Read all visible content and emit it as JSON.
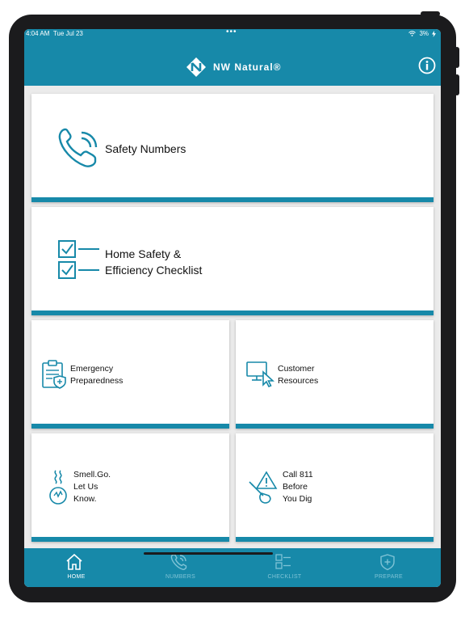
{
  "statusbar": {
    "time": "4:04 AM",
    "date": "Tue Jul 23",
    "battery": "3%"
  },
  "header": {
    "brand": "NW Natural®",
    "logo_icon": "nw-natural-logo-icon",
    "info_icon": "info-icon"
  },
  "cards": {
    "safety_numbers": "Safety Numbers",
    "checklist_line1": "Home Safety &",
    "checklist_line2": "Efficiency Checklist",
    "emergency_line1": "Emergency",
    "emergency_line2": "Preparedness",
    "customer_line1": "Customer",
    "customer_line2": "Resources",
    "smell_line1": "Smell.Go.",
    "smell_line2": "Let Us",
    "smell_line3": "Know.",
    "call_line1": "Call 811",
    "call_line2": "Before",
    "call_line3": "You Dig"
  },
  "tabs": [
    {
      "label": "HOME",
      "icon": "home-icon",
      "active": true
    },
    {
      "label": "NUMBERS",
      "icon": "phone-icon",
      "active": false
    },
    {
      "label": "CHECKLIST",
      "icon": "checklist-icon",
      "active": false
    },
    {
      "label": "PREPARE",
      "icon": "shield-icon",
      "active": false
    }
  ],
  "colors": {
    "brand_blue": "#1789a9",
    "tab_inactive": "#7fc3d6",
    "background": "#ebebeb"
  }
}
